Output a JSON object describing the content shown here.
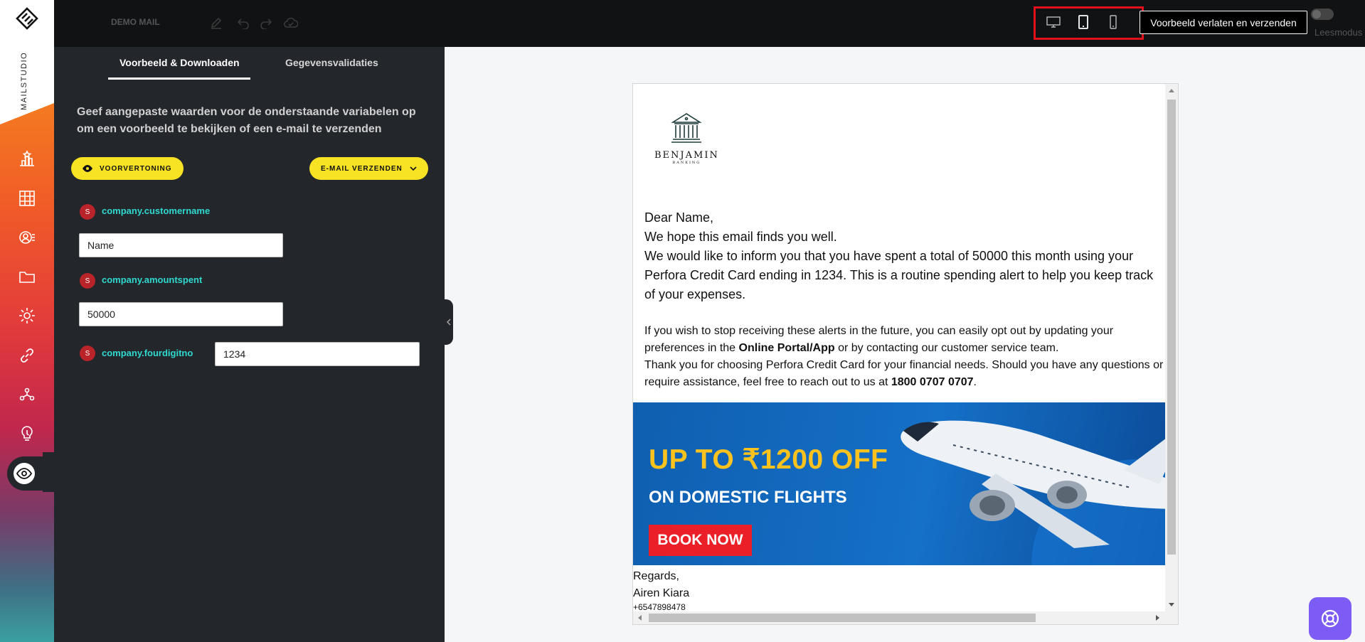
{
  "rail": {
    "brand": "MAILSTUDIO",
    "icons": [
      "ranking-icon",
      "analytics-icon",
      "audience-icon",
      "folder-icon",
      "settings-icon",
      "link-icon",
      "integrations-icon",
      "ideas-icon",
      "preview-eye-icon"
    ]
  },
  "topbar": {
    "mail_title": "DEMO MAIL",
    "exit_button": "Voorbeeld verlaten en verzenden",
    "reading_mode_label": "Leesmodus",
    "device_options": [
      "desktop",
      "tablet",
      "mobile"
    ],
    "selected_device": "tablet",
    "highlight_color": "#e0111a"
  },
  "panel": {
    "tabs": [
      {
        "label": "Voorbeeld & Downloaden",
        "active": true
      },
      {
        "label": "Gegevensvalidaties",
        "active": false
      }
    ],
    "description": "Geef aangepaste waarden voor de onderstaande variabelen op om een voorbeeld te bekijken of een e-mail te verzenden",
    "preview_button": "VOORVERTONING",
    "send_button": "E-MAIL VERZENDEN",
    "accent_color": "#f7e224",
    "variables": [
      {
        "badge": "S",
        "name": "company.customername",
        "value": "Name"
      },
      {
        "badge": "S",
        "name": "company.amountspent",
        "value": "50000"
      },
      {
        "badge": "S",
        "name": "company.fourdigitno",
        "value": "1234"
      }
    ]
  },
  "email": {
    "logo_name": "BENJAMIN",
    "logo_sub": "BANKING",
    "greeting": "Dear Name,",
    "line1": "We hope this email finds you well.",
    "line2": "We would like to inform you that you have spent a total of 50000  this month using your",
    "line3": "Perfora Credit Card ending in 1234. This is a routine spending alert to help you keep track",
    "line4": "of your expenses.",
    "p2_line1": "If you wish to stop receiving these alerts in the future, you can easily opt out by updating your",
    "p2_line2_pre": "preferences in the ",
    "p2_line2_bold": "Online Portal/App",
    "p2_line2_post": " or by contacting our customer service team.",
    "p2_line3": "Thank you for choosing Perfora Credit Card for your financial needs. Should you have any questions or",
    "p2_line4_pre": "require assistance, feel free to reach out to us at ",
    "p2_line4_bold": "1800 0707 0707",
    "p2_line4_post": ".",
    "banner_headline": "UP TO  ₹1200 OFF",
    "banner_sub": "ON DOMESTIC FLIGHTS",
    "banner_cta": "BOOK NOW",
    "regards": "Regards,",
    "signer": "Airen Kiara",
    "phone": "+6547898478"
  }
}
